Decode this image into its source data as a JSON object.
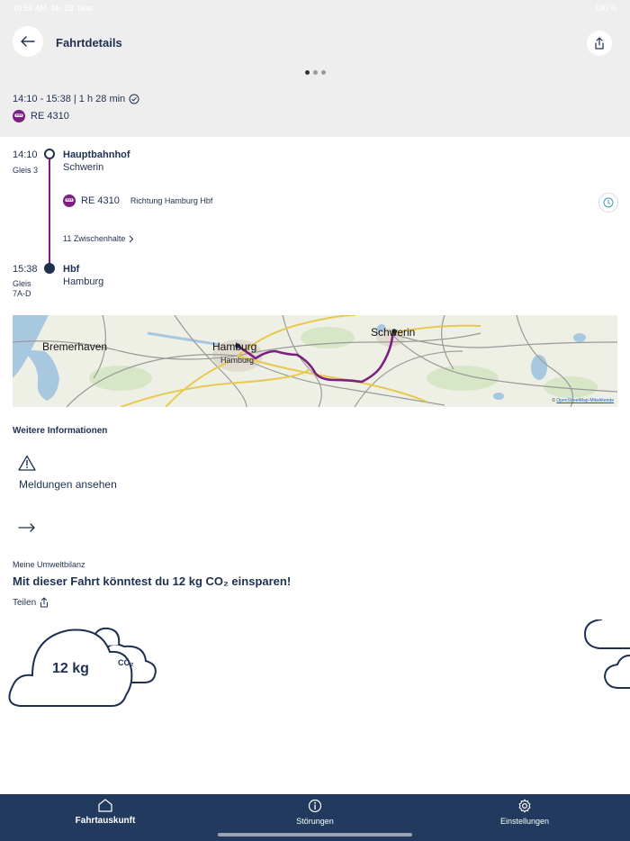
{
  "status_bar": {
    "time": "10:55 AM",
    "date": "Mi. 23. Nov.",
    "battery": "100 %"
  },
  "header": {
    "title": "Fahrtdetails",
    "summary": "14:10 - 15:38 | 1 h 28 min",
    "train": "RE 4310"
  },
  "journey": {
    "origin": {
      "time": "14:10",
      "platform": "Gleis 3",
      "name": "Hauptbahnhof",
      "city": "Schwerin"
    },
    "leg": {
      "train": "RE 4310",
      "direction": "Richtung Hamburg Hbf",
      "stops_link": "11 Zwischenhalte"
    },
    "destination": {
      "time": "15:38",
      "platform_label": "Gleis",
      "platform": "7A-D",
      "name": "Hbf",
      "city": "Hamburg"
    }
  },
  "map": {
    "labels": {
      "bremerhaven": "Bremerhaven",
      "hamburg": "Hamburg",
      "hamburg_sub": "Hamburg",
      "schwerin": "Schwerin"
    },
    "attribution_prefix": "© ",
    "attribution_link": "OpenStreetMap-Mitwirkende"
  },
  "further_info": {
    "title": "Weitere Informationen",
    "messages": "Meldungen ansehen"
  },
  "eco": {
    "label": "Meine Umweltbilanz",
    "headline": "Mit dieser Fahrt könntest du 12 kg CO₂ einsparen!",
    "share": "Teilen",
    "value": "12 kg",
    "co2": "CO₂"
  },
  "tabbar": {
    "tabs": [
      {
        "label": "Fahrtauskunft"
      },
      {
        "label": "Störungen"
      },
      {
        "label": "Einstellungen"
      }
    ]
  },
  "colors": {
    "brand_navy": "#223a5e",
    "route_purple": "#7d1f80",
    "text": "#1e3050",
    "header_bg": "#eeeeee"
  }
}
